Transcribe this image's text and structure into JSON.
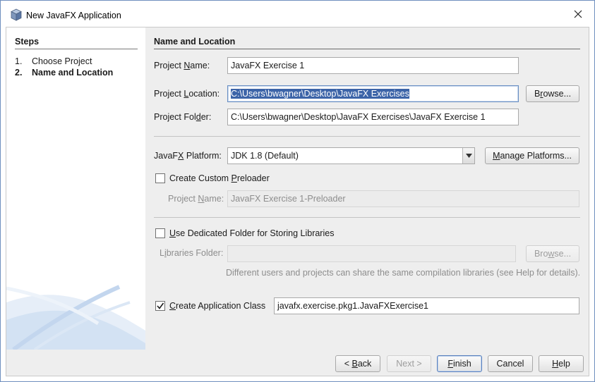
{
  "window": {
    "title": "New JavaFX Application"
  },
  "steps": {
    "title": "Steps",
    "items": [
      {
        "num": "1.",
        "label": "Choose Project"
      },
      {
        "num": "2.",
        "label": "Name and Location"
      }
    ]
  },
  "section_title": "Name and Location",
  "project_name": {
    "label_pre": "Project ",
    "label_key": "N",
    "label_post": "ame:",
    "value": "JavaFX Exercise 1"
  },
  "project_location": {
    "label_pre": "Project ",
    "label_key": "L",
    "label_post": "ocation:",
    "value": "C:\\Users\\bwagner\\Desktop\\JavaFX Exercises",
    "browse": {
      "key": "r",
      "pre": "B",
      "post": "owse..."
    }
  },
  "project_folder": {
    "label_pre": "Project Fol",
    "label_key": "d",
    "label_post": "er:",
    "value": "C:\\Users\\bwagner\\Desktop\\JavaFX Exercises\\JavaFX Exercise 1"
  },
  "platform": {
    "label_pre": "JavaF",
    "label_key": "X",
    "label_post": " Platform:",
    "value": "JDK 1.8 (Default)",
    "manage": {
      "pre": "",
      "key": "M",
      "post": "anage Platforms..."
    }
  },
  "preloader": {
    "checkbox_pre": "Create Custom ",
    "checkbox_key": "P",
    "checkbox_post": "reloader",
    "checked": false,
    "name_label_pre": "Project ",
    "name_label_key": "N",
    "name_label_post": "ame:",
    "name_value": "JavaFX Exercise 1-Preloader"
  },
  "libraries": {
    "checkbox_pre": "",
    "checkbox_key": "U",
    "checkbox_post": "se Dedicated Folder for Storing Libraries",
    "checked": false,
    "folder_label_pre": "L",
    "folder_label_key": "i",
    "folder_label_post": "braries Folder:",
    "folder_value": "",
    "browse": {
      "pre": "Bro",
      "key": "w",
      "post": "se..."
    },
    "hint": "Different users and projects can share the same compilation libraries (see Help for details)."
  },
  "app_class": {
    "checkbox_pre": "",
    "checkbox_key": "C",
    "checkbox_post": "reate Application Class",
    "checked": true,
    "value": "javafx.exercise.pkg1.JavaFXExercise1"
  },
  "footer": {
    "back": {
      "pre": "< ",
      "key": "B",
      "post": "ack"
    },
    "next": "Next >",
    "finish": {
      "pre": "",
      "key": "F",
      "post": "inish"
    },
    "cancel": "Cancel",
    "help": {
      "pre": "",
      "key": "H",
      "post": "elp"
    }
  },
  "colors": {
    "selection": "#3c64a8",
    "panel": "#eeeeee",
    "border": "#6f8fbf"
  },
  "icons": {
    "app": "javafx-cube-icon",
    "close": "close-icon",
    "dropdown": "chevron-down-icon",
    "check": "checkmark-icon"
  }
}
